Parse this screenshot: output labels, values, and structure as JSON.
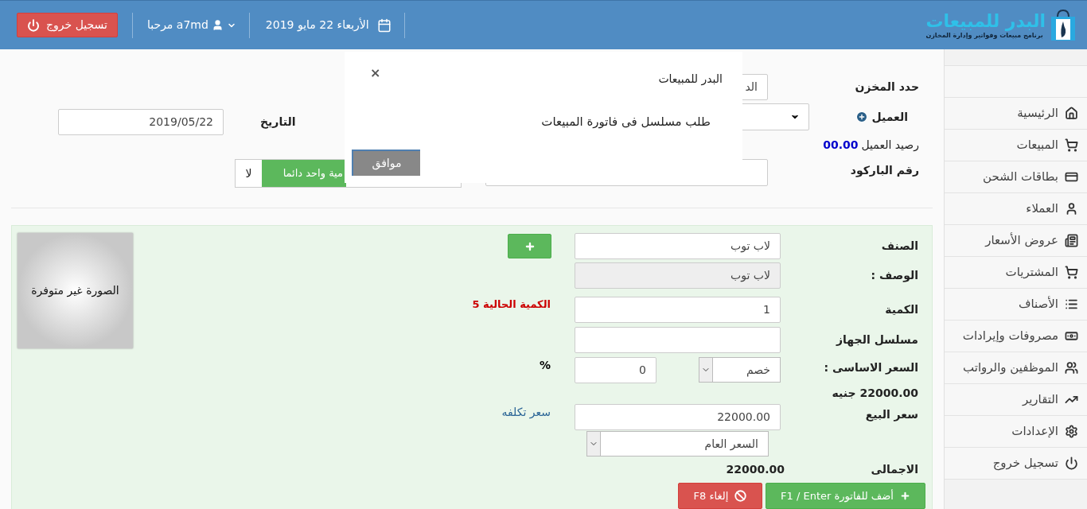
{
  "header": {
    "logout_button": "تسجيل خروج",
    "user": "a7md مرحبا",
    "date": "الأربعاء 22 مايو 2019",
    "logo_title": "البدر للمبيعات",
    "logo_subtitle": "برنامج مبيعات وفواتير وإدارة المخازن"
  },
  "sidebar": {
    "items": [
      {
        "label": "الرئيسية"
      },
      {
        "label": "المبيعات"
      },
      {
        "label": "بطاقات الشحن"
      },
      {
        "label": "العملاء"
      },
      {
        "label": "عروض الأسعار"
      },
      {
        "label": "المشتريات"
      },
      {
        "label": "الأصناف"
      },
      {
        "label": "مصروفات وإيرادات"
      },
      {
        "label": "الموظفين والرواتب"
      },
      {
        "label": "التقارير"
      },
      {
        "label": "الإعدادات"
      },
      {
        "label": "تسجيل خروج"
      }
    ]
  },
  "top_form": {
    "warehouse_label": "حدد المخزن",
    "warehouse_value": "الد",
    "customer_label": "العميل",
    "date_label": "التاريخ",
    "date_value": "2019/05/22",
    "balance_label": "رصيد العميل",
    "balance_value": "00.00",
    "barcode_label": "رقم الباركود",
    "quantity_toggle": "مية واحد دائما",
    "quantity_no": "لا"
  },
  "item_form": {
    "image_text": "الصورة غير متوفرة",
    "item_label": "الصنف",
    "item_value": "لاب توب",
    "description_label": "الوصف :",
    "description_value": "لاب توب",
    "quantity_label": "الكمية",
    "quantity_value": "1",
    "stock": "الكمية الحالية 5",
    "serial_label": "مسلسل الجهاز",
    "base_price_label": "السعر الاساسى :",
    "discount_type": "خصم",
    "discount_value": "0",
    "percent": "%",
    "base_price": "22000.00 جنيه",
    "sale_price_label": "سعر البيع",
    "sale_price_value": "22000.00",
    "cost_link": "سعر تكلفه",
    "price_list": "السعر العام",
    "total_label": "الاجمالى",
    "total_value": "22000.00",
    "add_button": "أضف للفاتورة F1 / Enter",
    "cancel_button": "إلغاء F8"
  },
  "dialog": {
    "title": "البدر للمبيعات",
    "close": "×",
    "message": "طلب مسلسل فى فاتورة المبيعات",
    "ok": "موافق"
  }
}
